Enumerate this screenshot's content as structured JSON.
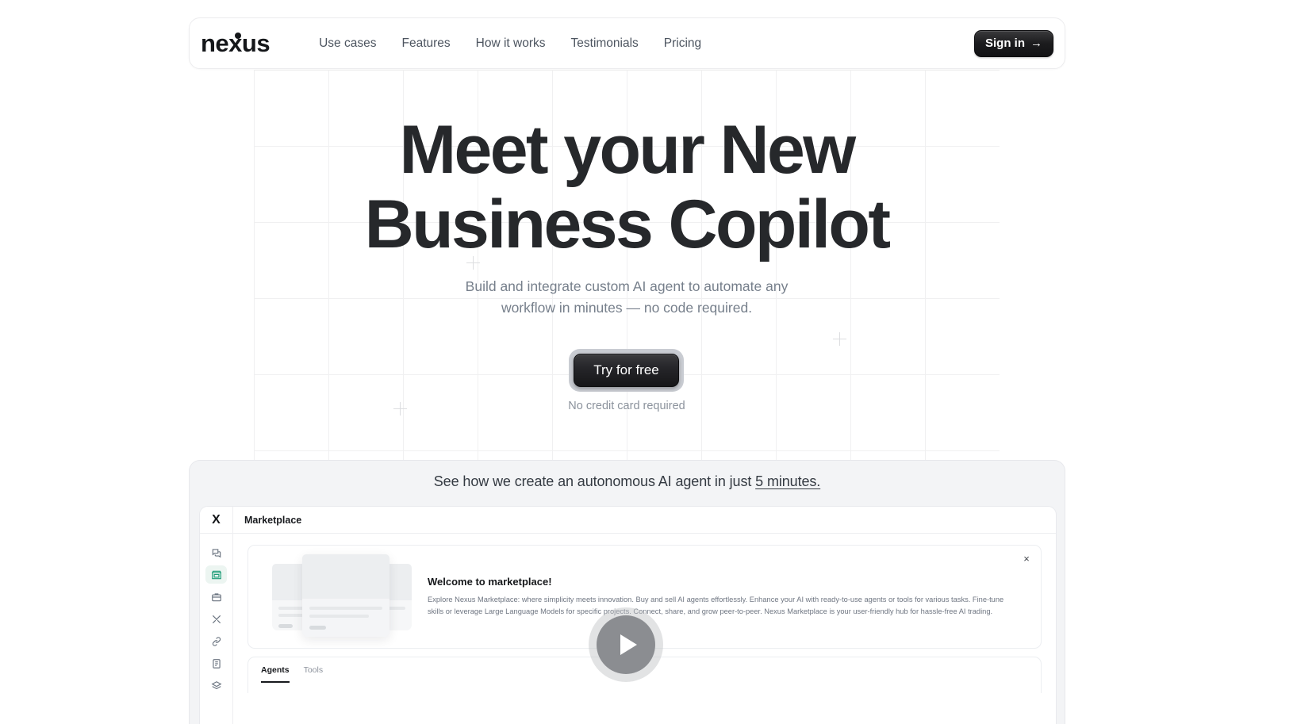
{
  "nav": {
    "logo": "nexus",
    "links": [
      {
        "label": "Use cases"
      },
      {
        "label": "Features"
      },
      {
        "label": "How it works"
      },
      {
        "label": "Testimonials"
      },
      {
        "label": "Pricing"
      }
    ],
    "signin_label": "Sign in",
    "signin_arrow": "→"
  },
  "hero": {
    "title_line1": "Meet your New",
    "title_line2": "Business Copilot",
    "sub_line1": "Build and integrate custom AI agent to automate any",
    "sub_line2": "workflow in minutes — no code required.",
    "cta_label": "Try for free",
    "cta_note": "No credit card required"
  },
  "demo": {
    "heading_prefix": "See how we create an autonomous AI agent in just ",
    "heading_link": "5 minutes.",
    "play_label": "play-button"
  },
  "app": {
    "logo": "X",
    "page_title": "Marketplace",
    "sidebar": [
      {
        "name": "chat-icon",
        "active": false
      },
      {
        "name": "marketplace-icon",
        "active": true
      },
      {
        "name": "briefcase-icon",
        "active": false
      },
      {
        "name": "tools-icon",
        "active": false
      },
      {
        "name": "link-icon",
        "active": false
      },
      {
        "name": "document-icon",
        "active": false
      },
      {
        "name": "layers-icon",
        "active": false
      }
    ],
    "welcome": {
      "title": "Welcome to marketplace!",
      "body": "Explore Nexus Marketplace: where simplicity meets innovation. Buy and sell AI agents effortlessly. Enhance your AI with ready-to-use agents or tools for various tasks. Fine-tune skills or leverage Large Language Models for specific projects. Connect, share, and grow peer-to-peer. Nexus Marketplace is your user-friendly hub for hassle-free AI trading.",
      "close_label": "×"
    },
    "tabs": [
      {
        "label": "Agents",
        "active": true
      },
      {
        "label": "Tools",
        "active": false
      }
    ]
  },
  "colors": {
    "accent_green": "#1d9c78",
    "dark": "#17191d",
    "muted": "#767f8b"
  }
}
